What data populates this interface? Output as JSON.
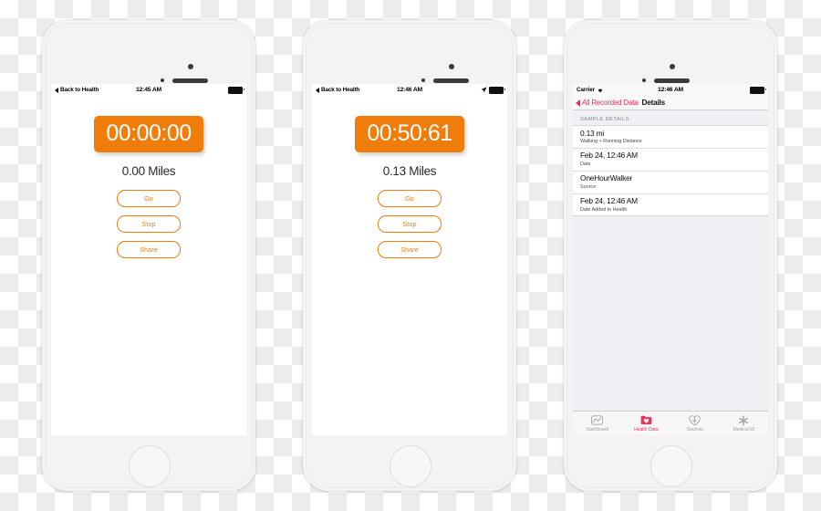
{
  "colors": {
    "accent_orange": "#f07d0a",
    "health_pink": "#fc2d55",
    "phone_body": "#f4f3f1",
    "tab_inactive": "#a0a0a5",
    "ios_group_bg": "#efeff4"
  },
  "phones": [
    {
      "id": "phone-tracker-idle",
      "status_bar": {
        "back_label": "Back to Health",
        "time": "12:45 AM",
        "has_location_arrow": false,
        "battery_icon": "battery-full-icon",
        "back_chevron_icon": "back-chevron-icon"
      },
      "timer": "00:00:00",
      "distance": "0.00 Miles",
      "buttons": [
        {
          "label": "Go",
          "name": "go-button"
        },
        {
          "label": "Stop",
          "name": "stop-button"
        },
        {
          "label": "Share",
          "name": "share-button"
        }
      ]
    },
    {
      "id": "phone-tracker-running",
      "status_bar": {
        "back_label": "Back to Health",
        "time": "12:46 AM",
        "has_location_arrow": true,
        "location_icon": "location-arrow-icon",
        "battery_icon": "battery-full-icon",
        "back_chevron_icon": "back-chevron-icon"
      },
      "timer": "00:50:61",
      "distance": "0.13 Miles",
      "buttons": [
        {
          "label": "Go",
          "name": "go-button"
        },
        {
          "label": "Stop",
          "name": "stop-button"
        },
        {
          "label": "Share",
          "name": "share-button"
        }
      ]
    }
  ],
  "health": {
    "status_bar": {
      "carrier": "Carrier",
      "wifi_icon": "wifi-icon",
      "time": "12:46 AM",
      "battery_icon": "battery-full-icon"
    },
    "navbar": {
      "back_label": "All Recorded Data",
      "back_chevron_icon": "back-chevron-icon",
      "title": "Details"
    },
    "section_header": "SAMPLE DETAILS",
    "rows": [
      {
        "value": "0.13 mi",
        "label": "Walking + Running Distance"
      },
      {
        "value": "Feb 24, 12:46 AM",
        "label": "Date"
      },
      {
        "value": "OneHourWalker",
        "label": "Source"
      },
      {
        "value": "Feb 24, 12:46 AM",
        "label": "Date Added to Health"
      }
    ],
    "tabs": [
      {
        "label": "Dashboard",
        "icon": "dashboard-chart-icon",
        "active": false
      },
      {
        "label": "Health Data",
        "icon": "health-folder-heart-icon",
        "active": true
      },
      {
        "label": "Sources",
        "icon": "heart-download-icon",
        "active": false
      },
      {
        "label": "Medical ID",
        "icon": "star-of-life-icon",
        "active": false
      }
    ]
  }
}
